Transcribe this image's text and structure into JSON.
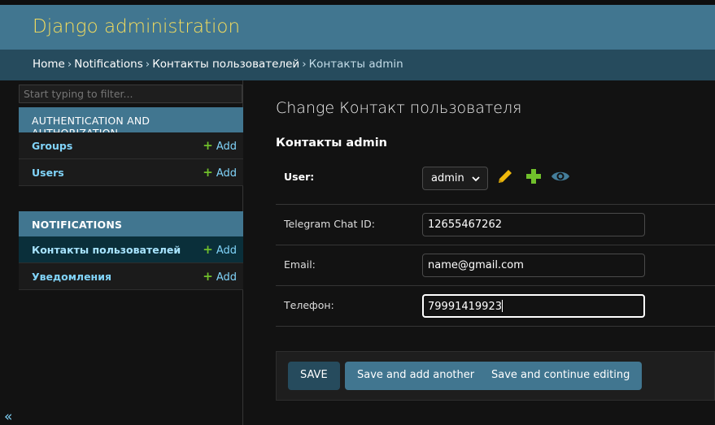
{
  "header": {
    "branding": "Django administration"
  },
  "breadcrumbs": {
    "items": [
      "Home",
      "Notifications",
      "Контакты пользователей",
      "Контакты admin"
    ],
    "separator": "›"
  },
  "sidebar": {
    "filter_placeholder": "Start typing to filter...",
    "modules": [
      {
        "caption": "AUTHENTICATION AND AUTHORIZATION",
        "rows": [
          {
            "label": "Groups",
            "add": "Add"
          },
          {
            "label": "Users",
            "add": "Add"
          }
        ]
      },
      {
        "caption": "NOTIFICATIONS",
        "rows": [
          {
            "label": "Контакты пользователей",
            "add": "Add",
            "current": true
          },
          {
            "label": "Уведомления",
            "add": "Add"
          }
        ]
      }
    ],
    "collapse_toggle": "«"
  },
  "content": {
    "title": "Change Контакт пользователя",
    "fieldset_title": "Контакты admin",
    "fields": {
      "user": {
        "label": "User:",
        "value": "admin"
      },
      "telegram": {
        "label": "Telegram Chat ID:",
        "value": "12655467262"
      },
      "email": {
        "label": "Email:",
        "value": "name@gmail.com"
      },
      "phone": {
        "label": "Телефон:",
        "value": "79991419923"
      }
    },
    "related_icons": [
      "pencil-icon",
      "plus-icon",
      "eye-icon"
    ],
    "buttons": {
      "save": "SAVE",
      "save_add_another": "Save and add another",
      "save_continue": "Save and continue editing"
    }
  },
  "colors": {
    "header": "#417690",
    "breadcrumbs": "#264b5d",
    "branding": "#f5dd5d",
    "link": "#81d4fa",
    "add_plus": "#70bf2b",
    "edit_icon": "#efb80b",
    "view_icon": "#447e9b"
  }
}
